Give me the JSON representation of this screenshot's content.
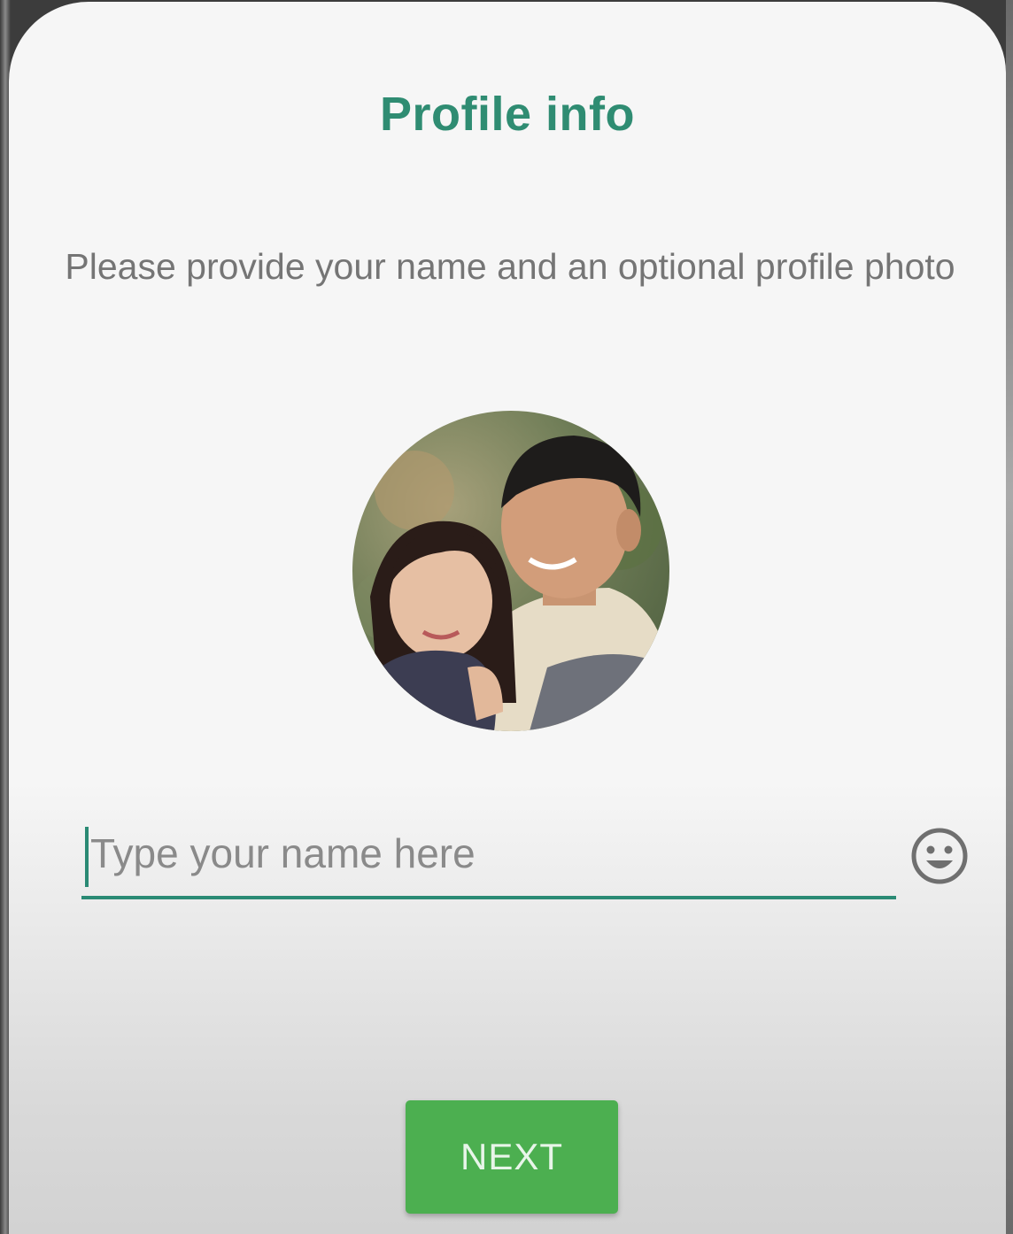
{
  "header": {
    "title": "Profile info"
  },
  "intro": {
    "text": "Please provide your name and an optional profile photo"
  },
  "profile_photo": {
    "icon": "profile-photo"
  },
  "name_field": {
    "value": "",
    "placeholder": "Type your name here",
    "accent_color": "#2a8a74"
  },
  "emoji_button": {
    "icon": "smiley-icon"
  },
  "next_button": {
    "label": "NEXT",
    "color": "#4caf50"
  },
  "colors": {
    "title": "#2f8c72",
    "body_text": "#757575",
    "background": "#f6f6f6"
  }
}
